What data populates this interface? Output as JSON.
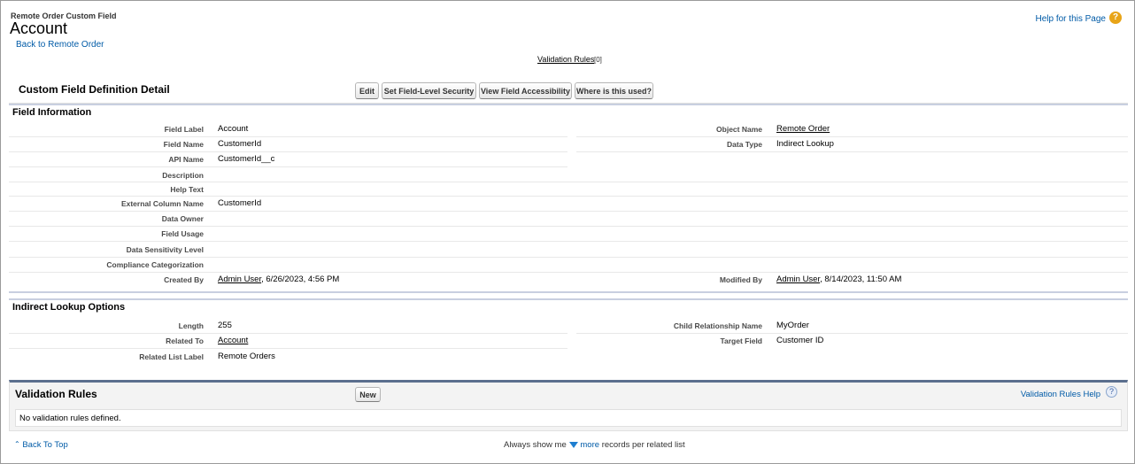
{
  "header": {
    "object_type": "Remote Order Custom Field",
    "title": "Account",
    "back_link": "Back to Remote Order",
    "help_link": "Help for this Page",
    "help_icon": "?"
  },
  "related_links": {
    "validation_rules": "Validation Rules",
    "validation_rules_count": "[0]"
  },
  "detail": {
    "title": "Custom Field Definition Detail",
    "buttons": {
      "edit": "Edit",
      "fls": "Set Field-Level Security",
      "accessibility": "View Field Accessibility",
      "where_used": "Where is this used?"
    }
  },
  "field_info": {
    "section_title": "Field Information",
    "left": [
      {
        "label": "Field Label",
        "value": "Account"
      },
      {
        "label": "Field Name",
        "value": "CustomerId"
      },
      {
        "label": "API Name",
        "value": "CustomerId__c"
      },
      {
        "label": "Description",
        "value": ""
      },
      {
        "label": "Help Text",
        "value": ""
      },
      {
        "label": "External Column Name",
        "value": "CustomerId"
      },
      {
        "label": "Data Owner",
        "value": ""
      },
      {
        "label": "Field Usage",
        "value": ""
      },
      {
        "label": "Data Sensitivity Level",
        "value": ""
      },
      {
        "label": "Compliance Categorization",
        "value": ""
      }
    ],
    "object_name_label": "Object Name",
    "object_name_value": "Remote Order",
    "data_type_label": "Data Type",
    "data_type_value": "Indirect Lookup",
    "created_by_label": "Created By",
    "created_by_user": "Admin User",
    "created_by_date": ", 6/26/2023, 4:56 PM",
    "modified_by_label": "Modified By",
    "modified_by_user": "Admin User",
    "modified_by_date": ", 8/14/2023, 11:50 AM"
  },
  "lookup_options": {
    "section_title": "Indirect Lookup Options",
    "length_label": "Length",
    "length_value": "255",
    "related_to_label": "Related To",
    "related_to_value": "Account",
    "related_list_label_label": "Related List Label",
    "related_list_label_value": "Remote Orders",
    "child_rel_label": "Child Relationship Name",
    "child_rel_value": "MyOrder",
    "target_field_label": "Target Field",
    "target_field_value": "Customer ID"
  },
  "validation_panel": {
    "title": "Validation Rules",
    "new_button": "New",
    "help_link": "Validation Rules Help",
    "help_icon": "?",
    "empty_message": "No validation rules defined."
  },
  "footer": {
    "back_to_top": "Back To Top",
    "always_show": "Always show me",
    "more": "more",
    "records_text": "records per related list"
  },
  "colors": {
    "link": "#015ba7",
    "help_icon": "#e8a417",
    "section_border": "#c8cfe0",
    "panel_top_border": "#5b6f8e"
  }
}
